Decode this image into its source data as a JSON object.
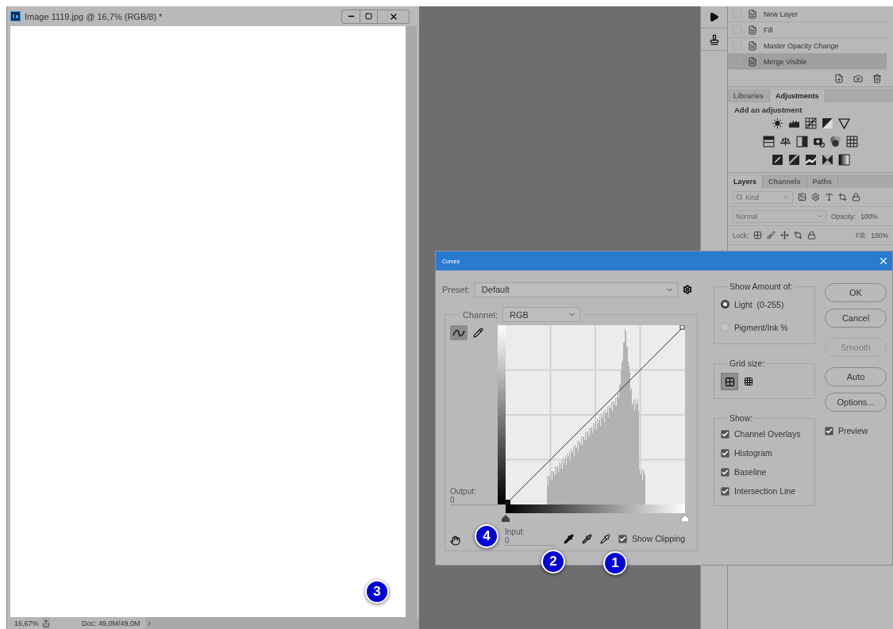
{
  "document": {
    "title": "Image 1119.jpg @ 16,7% (RGB/8) *",
    "zoom": "16,67%",
    "doc_info": "Doc: 49,0M/49,0M"
  },
  "history": [
    {
      "label": "New Layer",
      "selected": false
    },
    {
      "label": "Fill",
      "selected": false
    },
    {
      "label": "Master Opacity Change",
      "selected": false
    },
    {
      "label": "Merge Visible",
      "selected": true
    }
  ],
  "adjustments_panel": {
    "tabs": [
      {
        "label": "Libraries",
        "selected": false
      },
      {
        "label": "Adjustments",
        "selected": true
      }
    ],
    "heading": "Add an adjustment"
  },
  "layers_panel": {
    "tabs": [
      {
        "label": "Layers",
        "selected": true
      },
      {
        "label": "Channels",
        "selected": false
      },
      {
        "label": "Paths",
        "selected": false
      }
    ],
    "filter": "Kind",
    "blend_mode": "Normal",
    "opacity_label": "Opacity:",
    "opacity": "100%",
    "lock_label": "Lock:",
    "fill_label": "Fill:",
    "fill": "100%"
  },
  "curves_dialog": {
    "title": "Curves",
    "preset_label": "Preset:",
    "preset": "Default",
    "channel_label": "Channel:",
    "channel": "RGB",
    "tools": [
      {
        "kind": "curve",
        "selected": true
      },
      {
        "kind": "pencil",
        "selected": false
      }
    ],
    "input_sliders": [
      {
        "kind": "black_point",
        "level": 0
      },
      {
        "kind": "white_point",
        "level": 1
      }
    ],
    "output_label": "Output:",
    "output": "0",
    "input_label": "Input:",
    "input": "0",
    "show_clipping": {
      "label": "Show Clipping",
      "checked": true
    },
    "show_amount": {
      "title": "Show Amount of:",
      "options": [
        {
          "label": "Light  (0-255)",
          "selected": true
        },
        {
          "label": "Pigment/Ink %",
          "selected": false
        }
      ]
    },
    "grid_size": {
      "title": "Grid size:",
      "options": [
        {
          "kind": "simple",
          "selected": true
        },
        {
          "kind": "detailed",
          "selected": false
        }
      ]
    },
    "show": {
      "title": "Show:",
      "options": [
        {
          "label": "Channel Overlays",
          "checked": true
        },
        {
          "label": "Histogram",
          "checked": true
        },
        {
          "label": "Baseline",
          "checked": true
        },
        {
          "label": "Intersection Line",
          "checked": true
        }
      ]
    },
    "buttons": [
      {
        "label": "OK",
        "disabled": false
      },
      {
        "label": "Cancel",
        "disabled": false
      },
      {
        "label": "Smooth",
        "disabled": true
      },
      {
        "label": "Auto",
        "disabled": false
      },
      {
        "label": "Options...",
        "disabled": false
      }
    ],
    "preview": {
      "label": "Preview",
      "checked": true
    }
  },
  "annotations": [
    {
      "label": "1"
    },
    {
      "label": "2"
    },
    {
      "label": "3"
    },
    {
      "label": "4"
    }
  ]
}
